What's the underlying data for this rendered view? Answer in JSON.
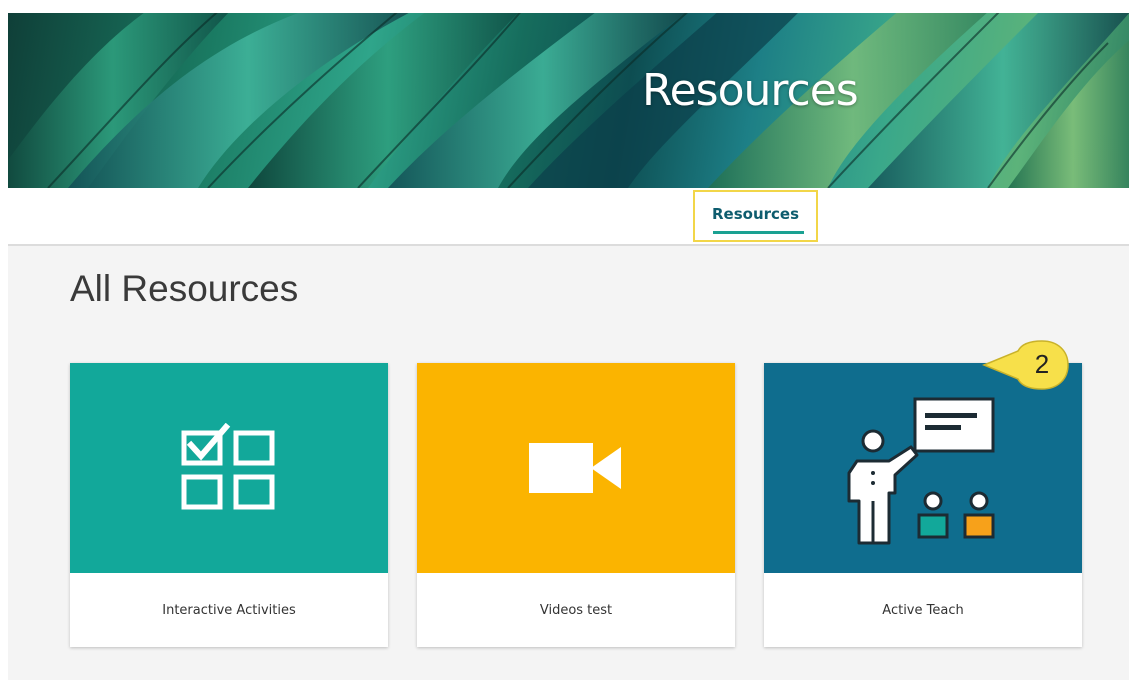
{
  "banner": {
    "title": "Resources"
  },
  "tabs": [
    {
      "label": "Resources",
      "active": true
    }
  ],
  "section": {
    "title": "All Resources"
  },
  "cards": [
    {
      "label": "Interactive Activities",
      "color": "#12a89a",
      "icon": "checklist-grid-icon"
    },
    {
      "label": "Videos test",
      "color": "#fbb400",
      "icon": "video-camera-icon"
    },
    {
      "label": "Active Teach",
      "color": "#0f6d8e",
      "icon": "teacher-presentation-icon"
    }
  ],
  "callout": {
    "number": "2",
    "color": "#f7e04a"
  },
  "colors": {
    "tab_text": "#0d5c6e",
    "tab_underline": "#1aa192",
    "highlight_border": "#f2d648"
  }
}
